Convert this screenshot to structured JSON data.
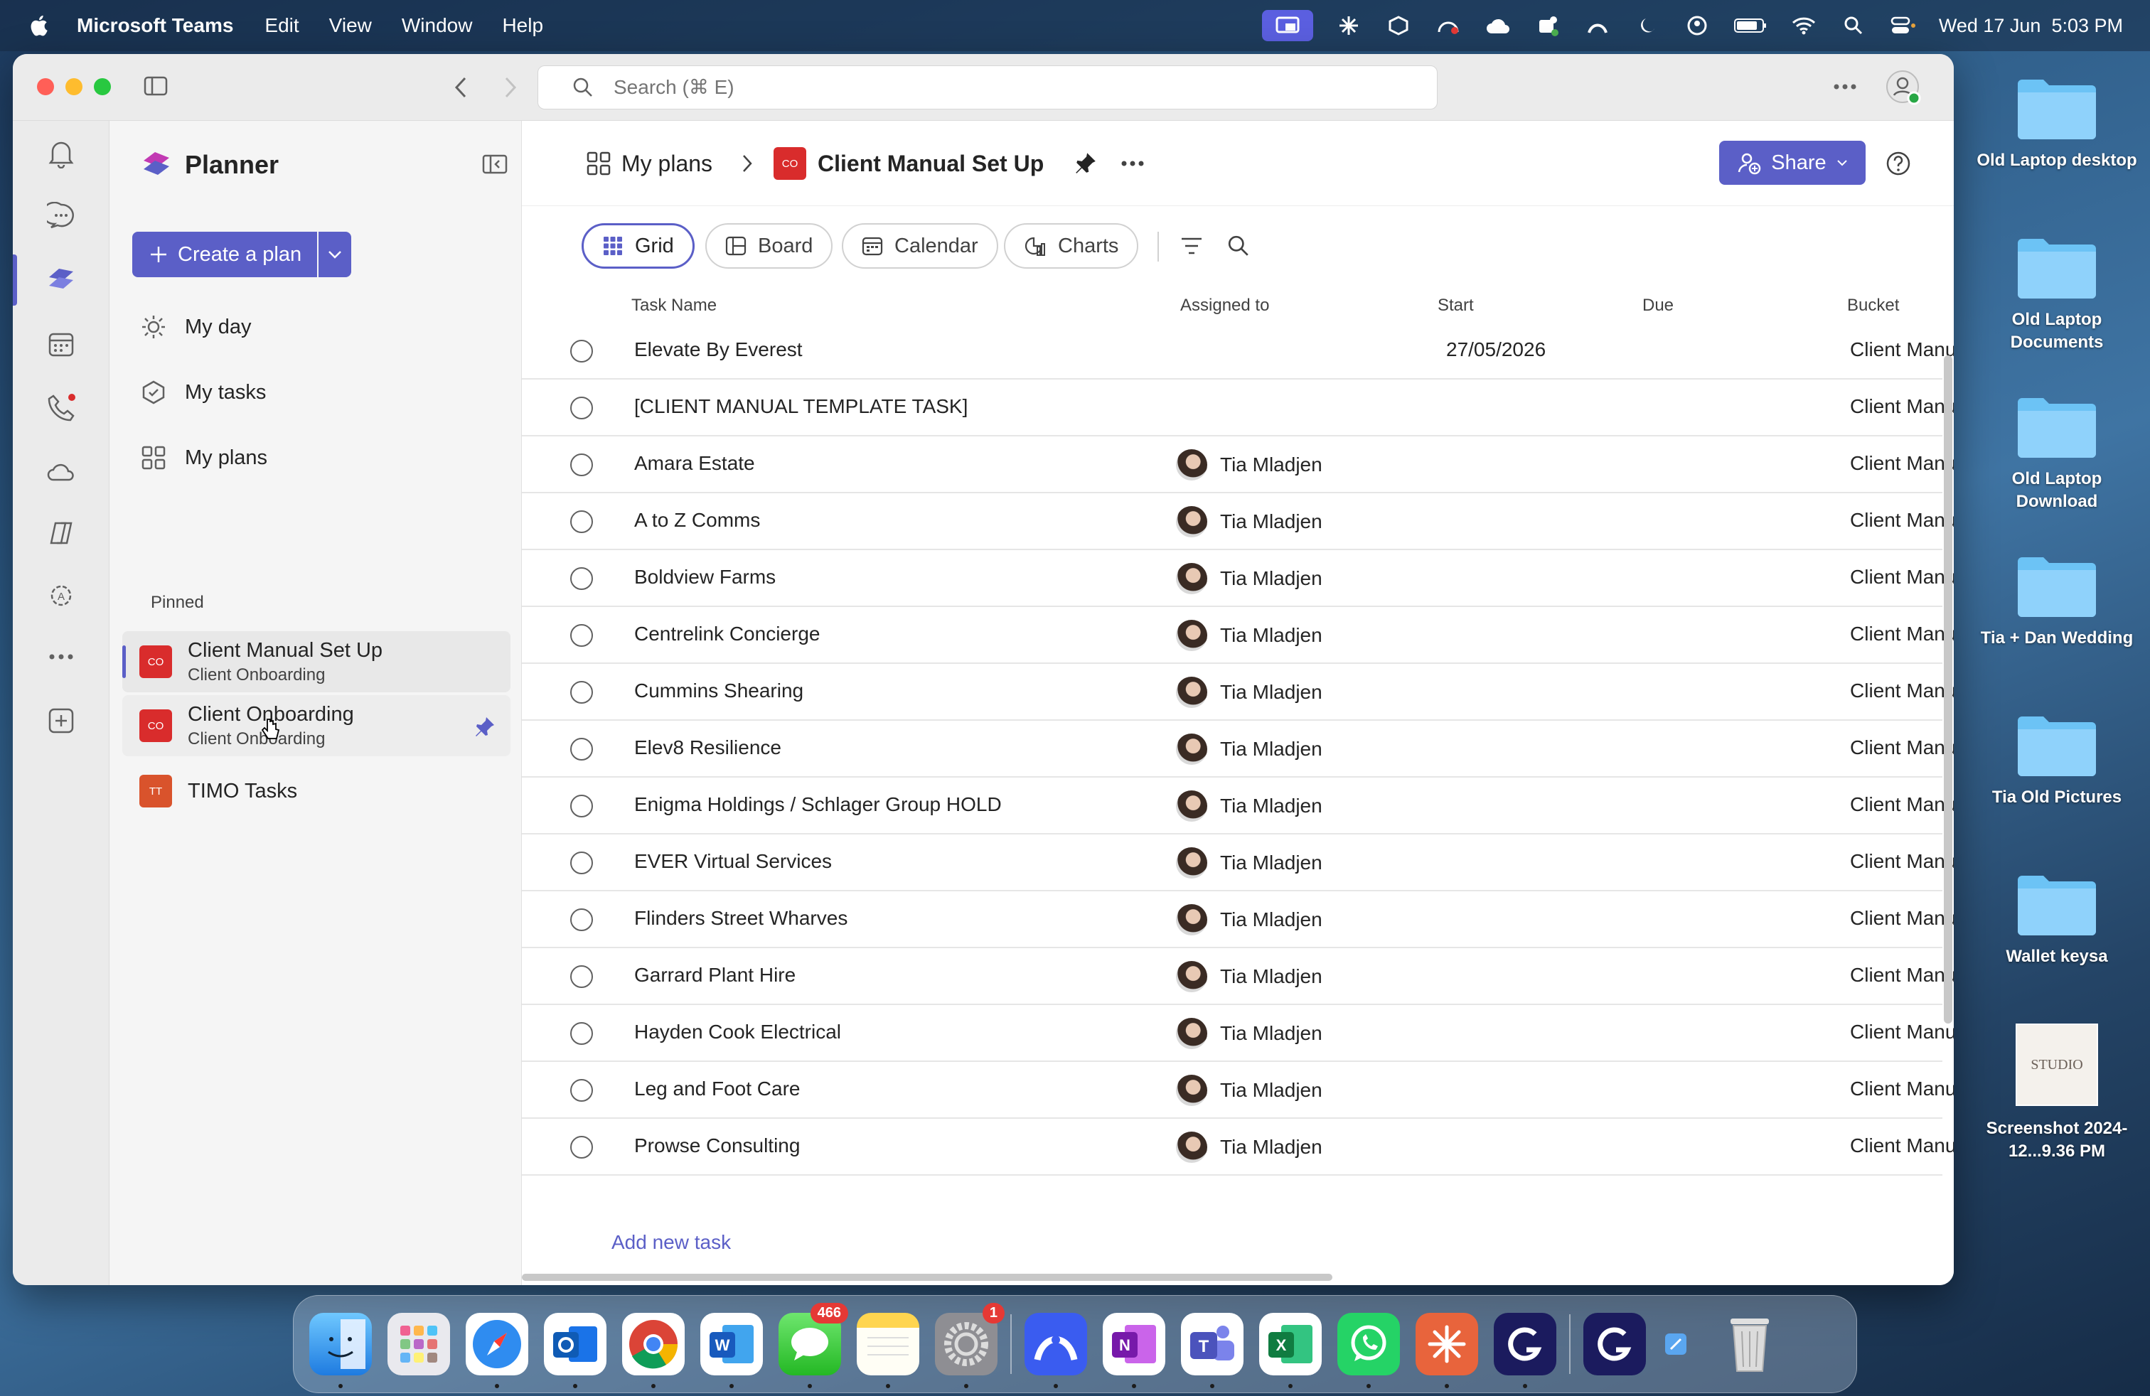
{
  "menubar": {
    "app_name": "Microsoft Teams",
    "menus": [
      "Edit",
      "View",
      "Window",
      "Help"
    ],
    "clock": "Wed 17 Jun  5:03 PM"
  },
  "search": {
    "placeholder": "Search (⌘ E)"
  },
  "sidebar": {
    "app_title": "Planner",
    "create_plan_label": "Create a plan",
    "nav": [
      {
        "label": "My day",
        "icon": "sun-icon"
      },
      {
        "label": "My tasks",
        "icon": "tasks-icon"
      },
      {
        "label": "My plans",
        "icon": "grid-icon"
      }
    ],
    "pinned_heading": "Pinned",
    "pinned": [
      {
        "badge": "CO",
        "title": "Client Manual Set Up",
        "subtitle": "Client Onboarding",
        "color": "#d92c2c",
        "selected": true
      },
      {
        "badge": "CO",
        "title": "Client Onboarding",
        "subtitle": "Client Onboarding",
        "color": "#d92c2c",
        "pinned_icon": true
      },
      {
        "badge": "TT",
        "title": "TIMO Tasks",
        "subtitle": "",
        "color": "#d9532c"
      }
    ]
  },
  "header": {
    "breadcrumb_root": "My plans",
    "plan_badge": "CO",
    "plan_title": "Client Manual Set Up",
    "share_label": "Share"
  },
  "views": [
    "Grid",
    "Board",
    "Calendar",
    "Charts"
  ],
  "table": {
    "columns": [
      "Task Name",
      "Assigned to",
      "Start",
      "Due",
      "Bucket"
    ],
    "rows": [
      {
        "name": "Elevate By Everest",
        "assignee": "",
        "start": "27/05/2026",
        "bucket": "Client Manu"
      },
      {
        "name": "[CLIENT MANUAL TEMPLATE TASK]",
        "assignee": "",
        "start": "",
        "bucket": "Client Manu"
      },
      {
        "name": "Amara Estate",
        "assignee": "Tia Mladjen",
        "start": "",
        "bucket": "Client Manu"
      },
      {
        "name": "A to Z Comms",
        "assignee": "Tia Mladjen",
        "start": "",
        "bucket": "Client Manu"
      },
      {
        "name": "Boldview Farms",
        "assignee": "Tia Mladjen",
        "start": "",
        "bucket": "Client Manu"
      },
      {
        "name": "Centrelink Concierge",
        "assignee": "Tia Mladjen",
        "start": "",
        "bucket": "Client Manu"
      },
      {
        "name": "Cummins Shearing",
        "assignee": "Tia Mladjen",
        "start": "",
        "bucket": "Client Manu"
      },
      {
        "name": "Elev8 Resilience",
        "assignee": "Tia Mladjen",
        "start": "",
        "bucket": "Client Manu"
      },
      {
        "name": "Enigma Holdings / Schlager Group HOLD",
        "assignee": "Tia Mladjen",
        "start": "",
        "bucket": "Client Manu"
      },
      {
        "name": "EVER Virtual Services",
        "assignee": "Tia Mladjen",
        "start": "",
        "bucket": "Client Manu"
      },
      {
        "name": "Flinders Street Wharves",
        "assignee": "Tia Mladjen",
        "start": "",
        "bucket": "Client Manu"
      },
      {
        "name": "Garrard Plant Hire",
        "assignee": "Tia Mladjen",
        "start": "",
        "bucket": "Client Manu"
      },
      {
        "name": "Hayden Cook Electrical",
        "assignee": "Tia Mladjen",
        "start": "",
        "bucket": "Client Manu"
      },
      {
        "name": "Leg and Foot Care",
        "assignee": "Tia Mladjen",
        "start": "",
        "bucket": "Client Manu"
      },
      {
        "name": "Prowse Consulting",
        "assignee": "Tia Mladjen",
        "start": "",
        "bucket": "Client Manu"
      }
    ],
    "add_task_label": "Add new task"
  },
  "desktop": [
    {
      "label": "Old Laptop desktop",
      "kind": "folder"
    },
    {
      "label": "Old Laptop Documents",
      "kind": "folder"
    },
    {
      "label": "Old Laptop Download",
      "kind": "folder"
    },
    {
      "label": "Tia + Dan Wedding",
      "kind": "folder"
    },
    {
      "label": "Tia Old Pictures",
      "kind": "folder"
    },
    {
      "label": "Wallet keysa",
      "kind": "folder"
    },
    {
      "label": "Screenshot 2024-12...9.36 PM",
      "kind": "screenshot",
      "thumb_text": "STUDIO"
    }
  ],
  "dock": {
    "messages_badge": "466",
    "settings_badge": "1"
  },
  "colors": {
    "accent": "#5b5fc7",
    "plan_badge": "#d92c2c",
    "folder": "#6cc3f5"
  }
}
